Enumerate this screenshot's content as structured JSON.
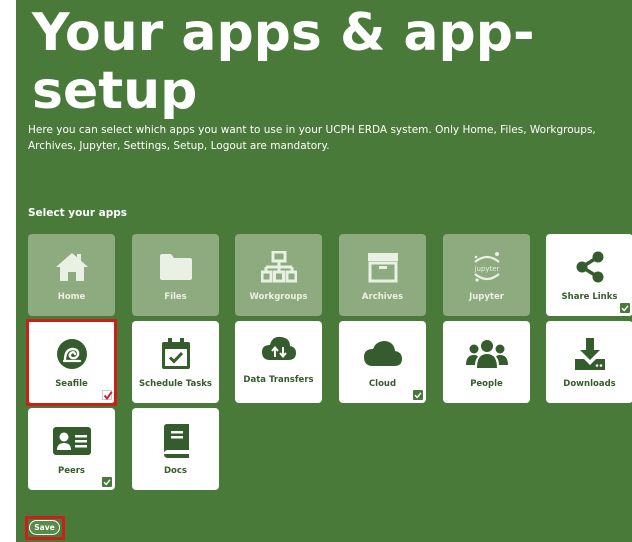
{
  "page": {
    "title": "Your apps & app-setup",
    "description": "Here you can select which apps you want to use in your UCPH ERDA system. Only Home, Files, Workgroups, Archives, Jupyter, Settings, Setup, Logout are mandatory.",
    "section_label": "Select your apps",
    "save_label": "Save"
  },
  "colors": {
    "background": "#4a7a3a",
    "tile_enabled": "#ffffff",
    "tile_mandatory": "#8eab7f",
    "icon_green": "#345c2c",
    "highlight_red": "#cc1f1a"
  },
  "apps": [
    {
      "label": "Home",
      "icon": "home-icon",
      "mandatory": true,
      "checked": false
    },
    {
      "label": "Files",
      "icon": "folder-icon",
      "mandatory": true,
      "checked": false
    },
    {
      "label": "Workgroups",
      "icon": "sitemap-icon",
      "mandatory": true,
      "checked": false
    },
    {
      "label": "Archives",
      "icon": "archive-box-icon",
      "mandatory": true,
      "checked": false
    },
    {
      "label": "Jupyter",
      "icon": "jupyter-logo-icon",
      "mandatory": true,
      "checked": false
    },
    {
      "label": "Share Links",
      "icon": "share-icon",
      "mandatory": false,
      "checked": true
    },
    {
      "label": "Seafile",
      "icon": "seafile-icon",
      "mandatory": false,
      "checked": true,
      "highlighted": true
    },
    {
      "label": "Schedule Tasks",
      "icon": "calendar-check-icon",
      "mandatory": false,
      "checked": false
    },
    {
      "label": "Data Transfers",
      "icon": "cloud-transfer-icon",
      "mandatory": false,
      "checked": false
    },
    {
      "label": "Cloud",
      "icon": "cloud-icon",
      "mandatory": false,
      "checked": true
    },
    {
      "label": "People",
      "icon": "people-icon",
      "mandatory": false,
      "checked": false
    },
    {
      "label": "Downloads",
      "icon": "download-icon",
      "mandatory": false,
      "checked": false
    },
    {
      "label": "Peers",
      "icon": "id-card-icon",
      "mandatory": false,
      "checked": true
    },
    {
      "label": "Docs",
      "icon": "book-icon",
      "mandatory": false,
      "checked": false
    }
  ]
}
